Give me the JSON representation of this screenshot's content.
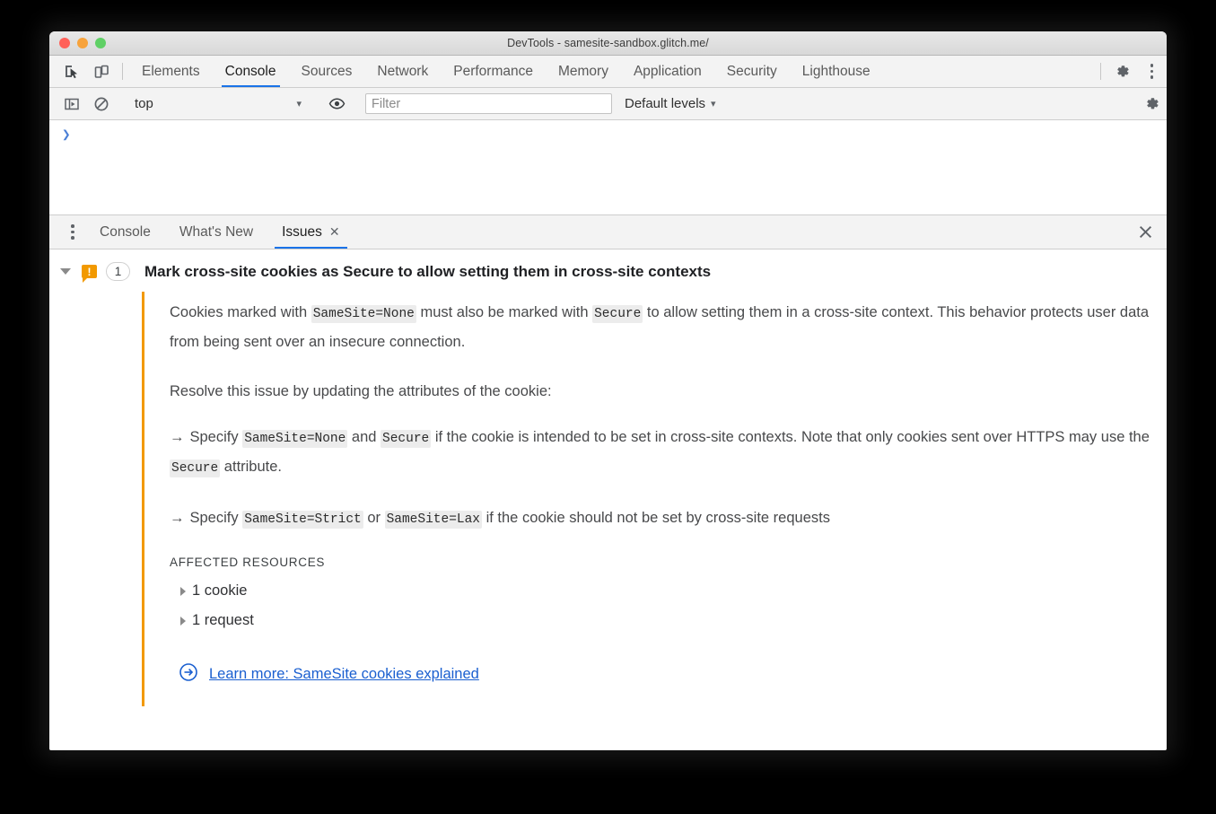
{
  "window": {
    "title": "DevTools - samesite-sandbox.glitch.me/"
  },
  "main_tabs": {
    "inspect_icon": "inspect-cursor-icon",
    "device_icon": "device-toolbar-icon",
    "items": [
      {
        "label": "Elements",
        "active": false
      },
      {
        "label": "Console",
        "active": true
      },
      {
        "label": "Sources",
        "active": false
      },
      {
        "label": "Network",
        "active": false
      },
      {
        "label": "Performance",
        "active": false
      },
      {
        "label": "Memory",
        "active": false
      },
      {
        "label": "Application",
        "active": false
      },
      {
        "label": "Security",
        "active": false
      },
      {
        "label": "Lighthouse",
        "active": false
      }
    ],
    "settings_icon": "gear-icon",
    "more_icon": "kebab-menu-icon"
  },
  "console_toolbar": {
    "sidebar_toggle_icon": "console-sidebar-icon",
    "clear_icon": "clear-console-icon",
    "context": "top",
    "context_caret": "▾",
    "eye_icon": "live-expression-eye-icon",
    "filter_placeholder": "Filter",
    "filter_value": "",
    "levels_label": "Default levels",
    "levels_caret": "▾",
    "settings_icon": "gear-icon"
  },
  "console_output": {
    "prompt": "❯"
  },
  "drawer": {
    "more_icon": "kebab-menu-icon",
    "tabs": [
      {
        "label": "Console",
        "active": false,
        "closable": false
      },
      {
        "label": "What's New",
        "active": false,
        "closable": false
      },
      {
        "label": "Issues",
        "active": true,
        "closable": true,
        "close_glyph": "✕"
      }
    ],
    "close_glyph": "✕",
    "close_icon": "close-drawer-icon"
  },
  "issue": {
    "expand_icon": "triangle-down-icon",
    "severity_icon": "warning-issue-icon",
    "severity_glyph": "!",
    "severity_color": "#f29900",
    "count": "1",
    "title": "Mark cross-site cookies as Secure to allow setting them in cross-site contexts",
    "paragraph1": {
      "part1": "Cookies marked with ",
      "code1": "SameSite=None",
      "part2": " must also be marked with ",
      "code2": "Secure",
      "part3": " to allow setting them in a cross-site context. This behavior protects user data from being sent over an insecure connection."
    },
    "paragraph2": "Resolve this issue by updating the attributes of the cookie:",
    "bullet1": {
      "arrow": "→",
      "part1": "Specify ",
      "code1": "SameSite=None",
      "part2": " and ",
      "code2": "Secure",
      "part3": " if the cookie is intended to be set in cross-site contexts. Note that only cookies sent over HTTPS may use the ",
      "code3": "Secure",
      "part4": " attribute."
    },
    "bullet2": {
      "arrow": "→",
      "part1": "Specify ",
      "code1": "SameSite=Strict",
      "part2": " or ",
      "code2": "SameSite=Lax",
      "part3": " if the cookie should not be set by cross-site requests"
    },
    "affected_heading": "AFFECTED RESOURCES",
    "resources": [
      {
        "label": "1 cookie",
        "icon": "triangle-right-icon"
      },
      {
        "label": "1 request",
        "icon": "triangle-right-icon"
      }
    ],
    "learn_more": {
      "icon": "circled-arrow-right-icon",
      "label": "Learn more: SameSite cookies explained",
      "color": "#1a5fd0"
    }
  }
}
